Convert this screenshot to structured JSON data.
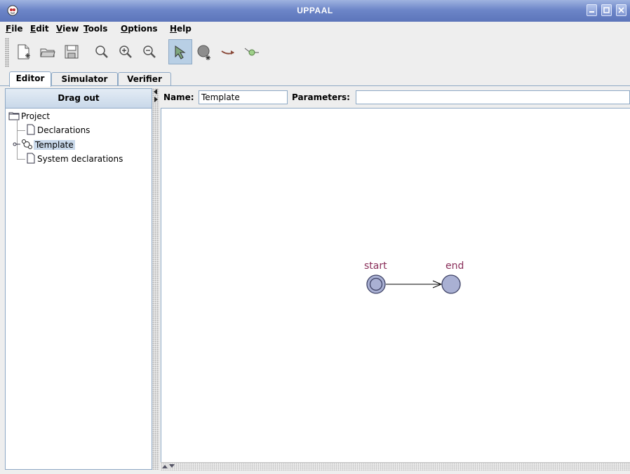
{
  "window": {
    "title": "UPPAAL",
    "app_icon": "uppaal-logo-icon",
    "controls": [
      "minimize-icon",
      "maximize-icon",
      "close-icon"
    ]
  },
  "menu": {
    "file": {
      "mnemonic": "F",
      "rest": "ile"
    },
    "edit": {
      "mnemonic": "E",
      "rest": "dit"
    },
    "view": {
      "mnemonic": "V",
      "rest": "iew"
    },
    "tools": {
      "mnemonic": "T",
      "rest": "ools"
    },
    "options": {
      "mnemonic": "O",
      "rest": "ptions"
    },
    "help": {
      "mnemonic": "H",
      "rest": "elp"
    }
  },
  "toolbar": {
    "buttons": [
      {
        "icon": "new-document-icon"
      },
      {
        "icon": "open-folder-icon"
      },
      {
        "icon": "save-icon"
      },
      {
        "icon": "zoom-icon"
      },
      {
        "icon": "zoom-in-icon"
      },
      {
        "icon": "zoom-out-icon"
      },
      {
        "icon": "select-arrow-icon",
        "active": true
      },
      {
        "icon": "add-location-icon"
      },
      {
        "icon": "add-edge-icon"
      },
      {
        "icon": "add-nail-icon"
      }
    ]
  },
  "tabs": {
    "editor": "Editor",
    "simulator": "Simulator",
    "verifier": "Verifier",
    "selected": "Editor"
  },
  "project_panel": {
    "drag_out": "Drag out",
    "tree": {
      "root": "Project",
      "declarations": "Declarations",
      "template": "Template",
      "system_declarations": "System declarations",
      "selected": "Template"
    }
  },
  "template_header": {
    "name_label": "Name:",
    "name_value": "Template",
    "parameters_label": "Parameters:",
    "parameters_value": ""
  },
  "automaton": {
    "locations": [
      {
        "name": "start",
        "initial": true
      },
      {
        "name": "end",
        "initial": false
      }
    ],
    "edges": [
      {
        "from": "start",
        "to": "end"
      }
    ],
    "colors": {
      "location_fill": "#a9b0d3",
      "location_stroke": "#3f4366",
      "label": "#8a2f5a"
    }
  },
  "colors": {
    "titlebar": "#6d86c8",
    "selection": "#c8d8ea",
    "border": "#8ea9c5"
  }
}
